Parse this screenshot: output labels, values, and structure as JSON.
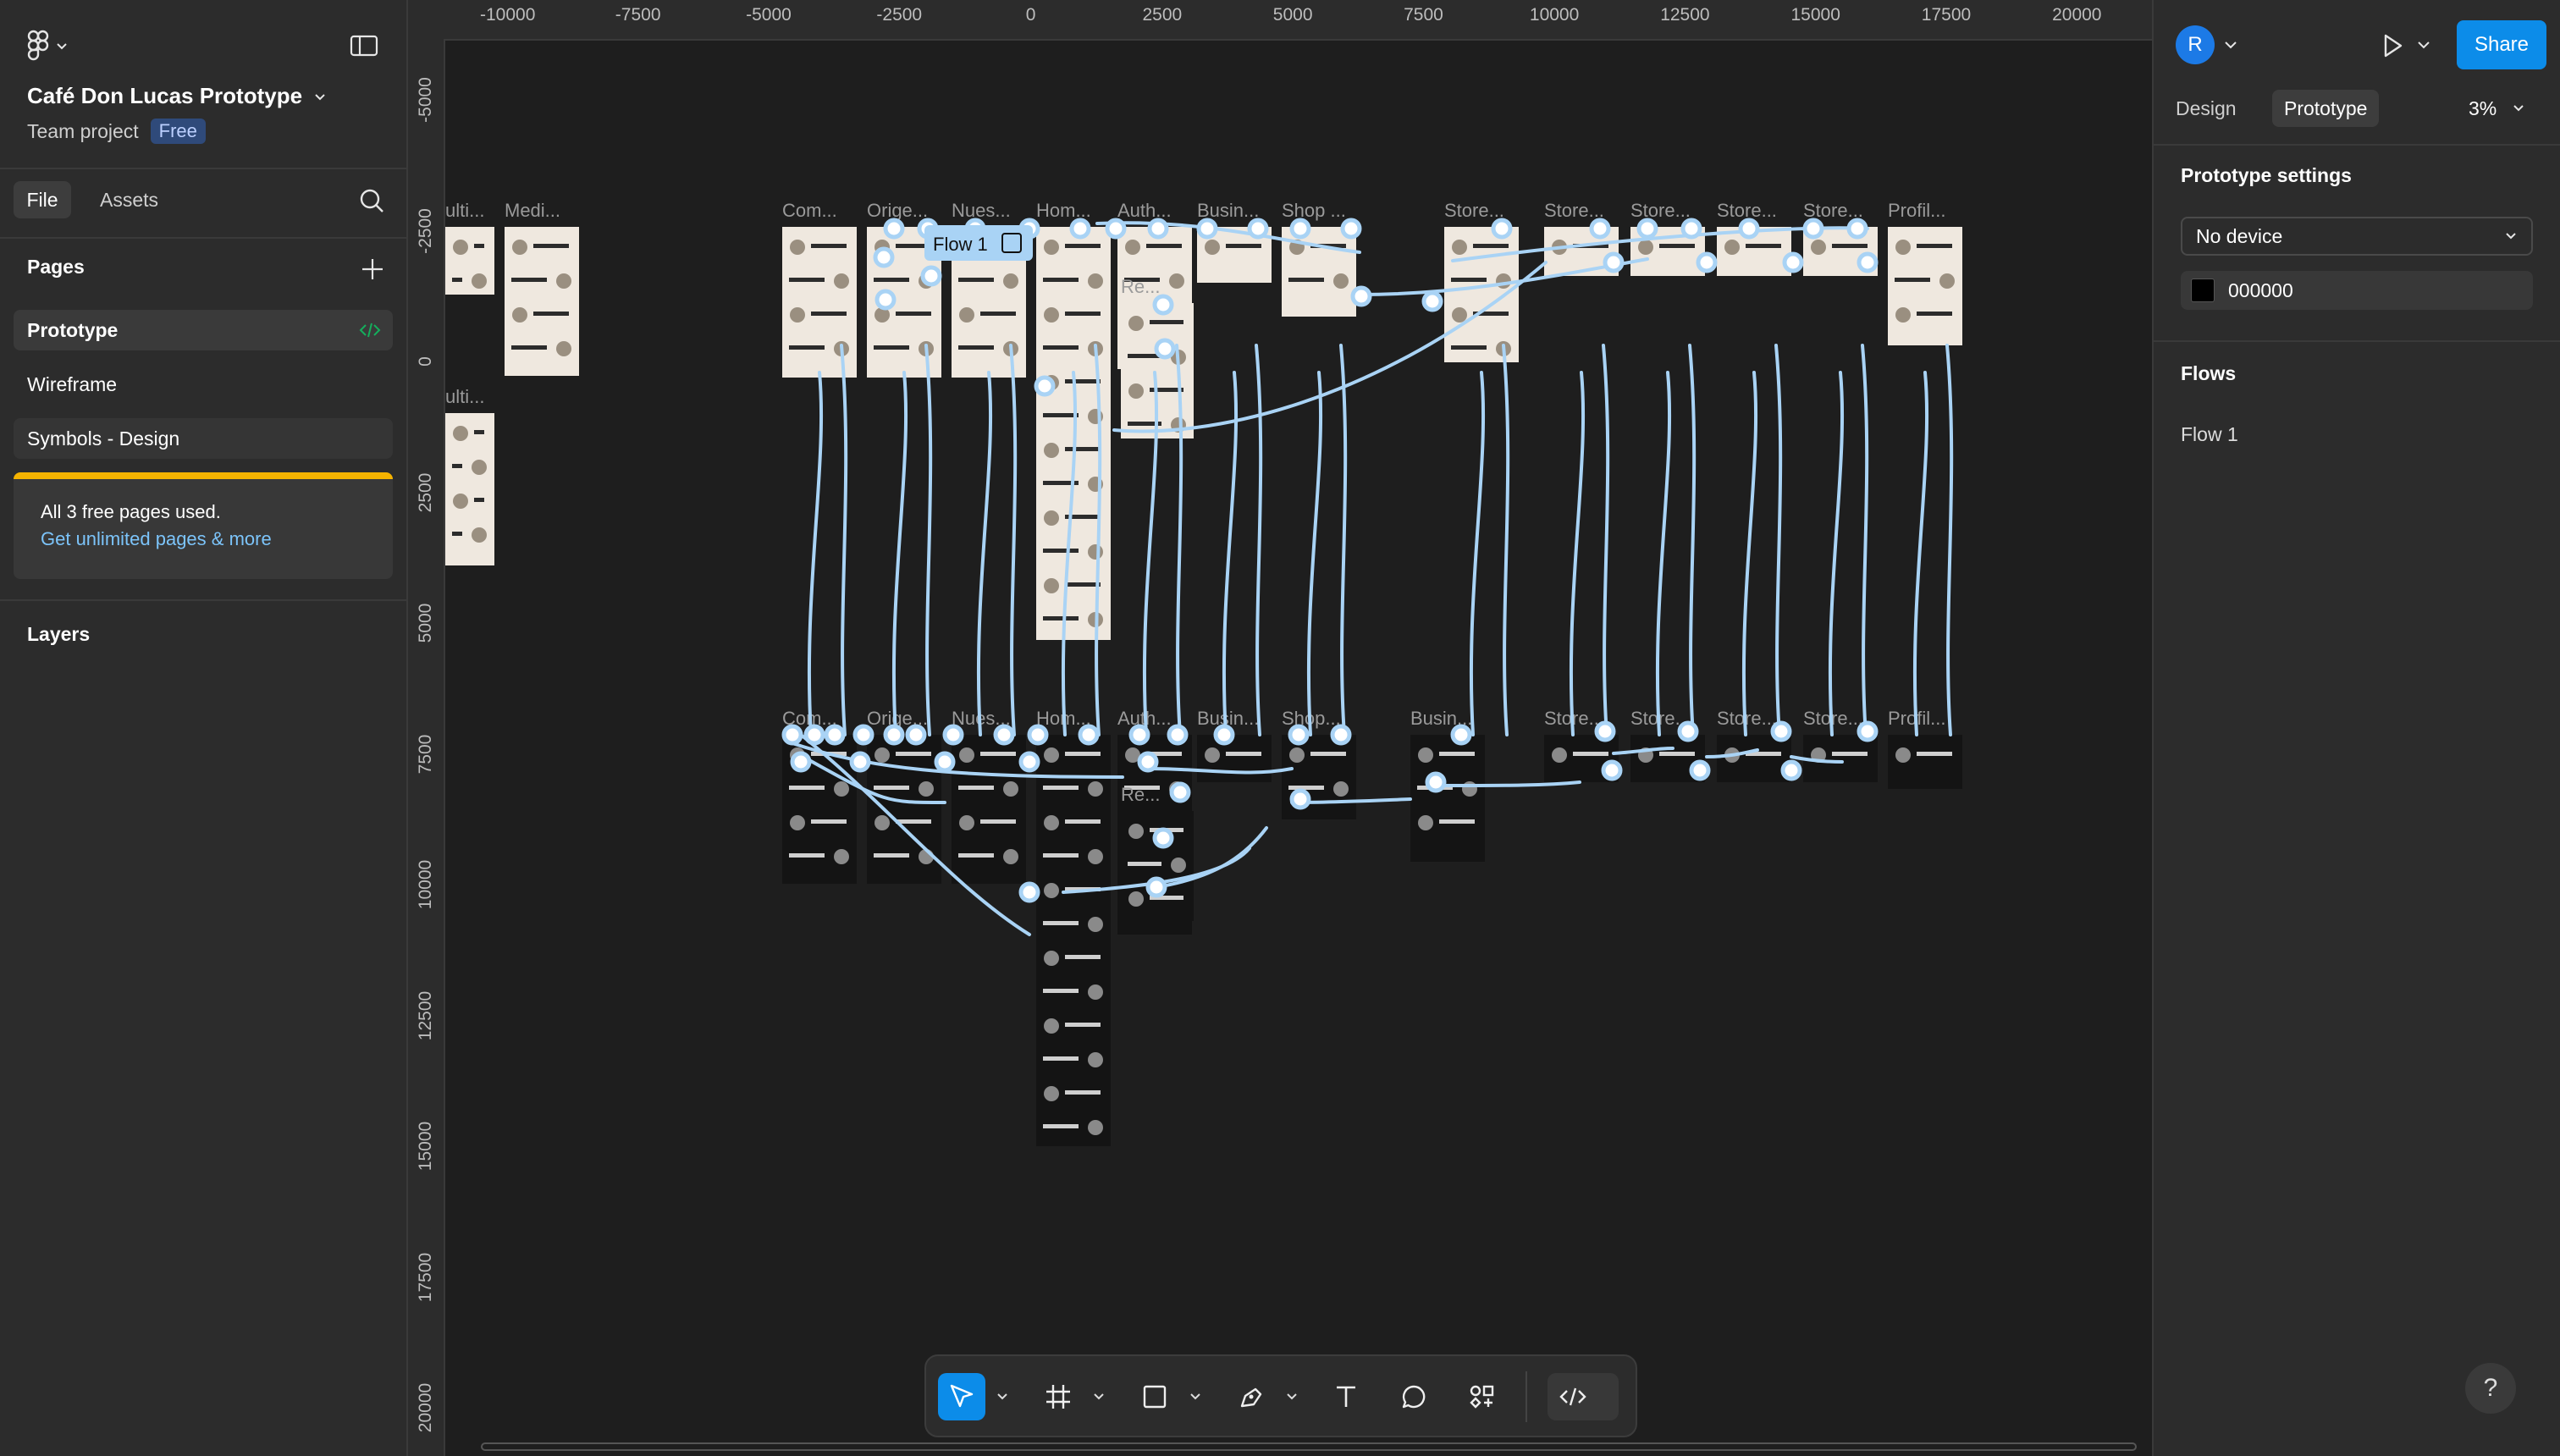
{
  "file": {
    "title": "Café Don Lucas Prototype",
    "subtitle": "Team project",
    "plan_badge": "Free"
  },
  "left_tabs": {
    "file": "File",
    "assets": "Assets"
  },
  "pages": {
    "title": "Pages",
    "items": [
      "Prototype",
      "Wireframe",
      "Symbols - Design"
    ]
  },
  "upsell": {
    "line1": "All 3 free pages used.",
    "line2": "Get unlimited pages & more"
  },
  "layers": {
    "title": "Layers"
  },
  "ruler": {
    "top": [
      "-10000",
      "-7500",
      "-5000",
      "-2500",
      "0",
      "2500",
      "5000",
      "7500",
      "10000",
      "12500",
      "15000",
      "17500",
      "20000"
    ],
    "left": [
      "-5000",
      "-2500",
      "0",
      "2500",
      "5000",
      "7500",
      "10000",
      "12500",
      "15000",
      "17500",
      "20000"
    ]
  },
  "canvas": {
    "flow_label": "Flow 1",
    "frames_top": [
      "Com...",
      "Orige...",
      "Nues...",
      "Hom...",
      "Auth...",
      "Busin...",
      "Shop ...",
      "Store...",
      "Store...",
      "Store...",
      "Store...",
      "Store...",
      "Profil..."
    ],
    "frames_bottom": [
      "Com...",
      "Orige...",
      "Nues...",
      "Hom...",
      "Auth...",
      "Busin...",
      "Shop...",
      "Busin...",
      "Store...",
      "Store...",
      "Store...",
      "Store...",
      "Profil..."
    ],
    "frames_left": [
      "ulti...",
      "Medi...",
      "ulti..."
    ],
    "frames_extra": [
      "Re...",
      "Re..."
    ]
  },
  "right": {
    "avatar_initial": "R",
    "share_label": "Share",
    "tab_design": "Design",
    "tab_prototype": "Prototype",
    "zoom": "3%",
    "settings_title": "Prototype settings",
    "device": "No device",
    "background_hex": "000000",
    "flows_title": "Flows",
    "flows": [
      "Flow 1"
    ],
    "help": "?"
  },
  "colors": {
    "accent": "#0c8ce9",
    "connector": "#a9d3f5",
    "warning": "#f5b300"
  }
}
